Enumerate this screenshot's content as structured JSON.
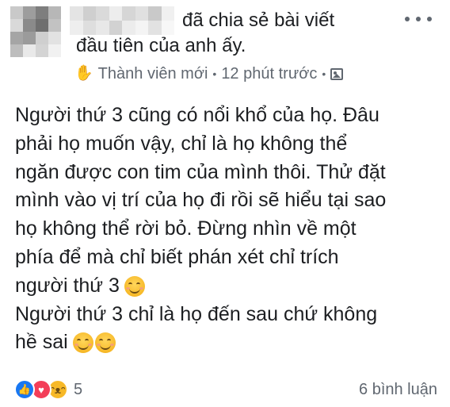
{
  "post": {
    "header": {
      "action_line1": "đã chia sẻ bài viết",
      "action_line2": "đầu tiên của anh ấy."
    },
    "meta": {
      "wave_icon": "wave-hand-icon",
      "badge": "Thành viên mới",
      "separator": "•",
      "time": "12 phút trước",
      "separator2": "•",
      "privacy_icon": "group-photo-icon"
    },
    "body": {
      "lines": [
        "Người thứ 3 cũng có nổi khổ của họ. Đâu",
        "phải họ muốn vậy, chỉ là họ không thể",
        "ngăn được con tim của mình thôi. Thử đặt",
        "mình vào vị trí của họ đi rồi sẽ hiểu tại sao",
        "họ không thể rời bỏ. Đừng nhìn về một",
        "phía để mà chỉ biết phán xét chỉ trích",
        "người thứ 3",
        "Người thứ 3 chỉ là họ đến sau chứ không",
        "hề sai"
      ],
      "emoji": "smiling-face-icon"
    },
    "footer": {
      "reaction_icons": [
        "like-icon",
        "love-icon",
        "haha-icon"
      ],
      "like_glyph": "👍",
      "love_glyph": "♥",
      "haha_glyph": "😆",
      "reaction_count": "5",
      "comments": "6 bình luận"
    }
  },
  "colors": {
    "text": "#1c1e21",
    "secondary": "#606770",
    "like": "#1877f2",
    "love": "#f33e58",
    "haha": "#f7b928"
  }
}
